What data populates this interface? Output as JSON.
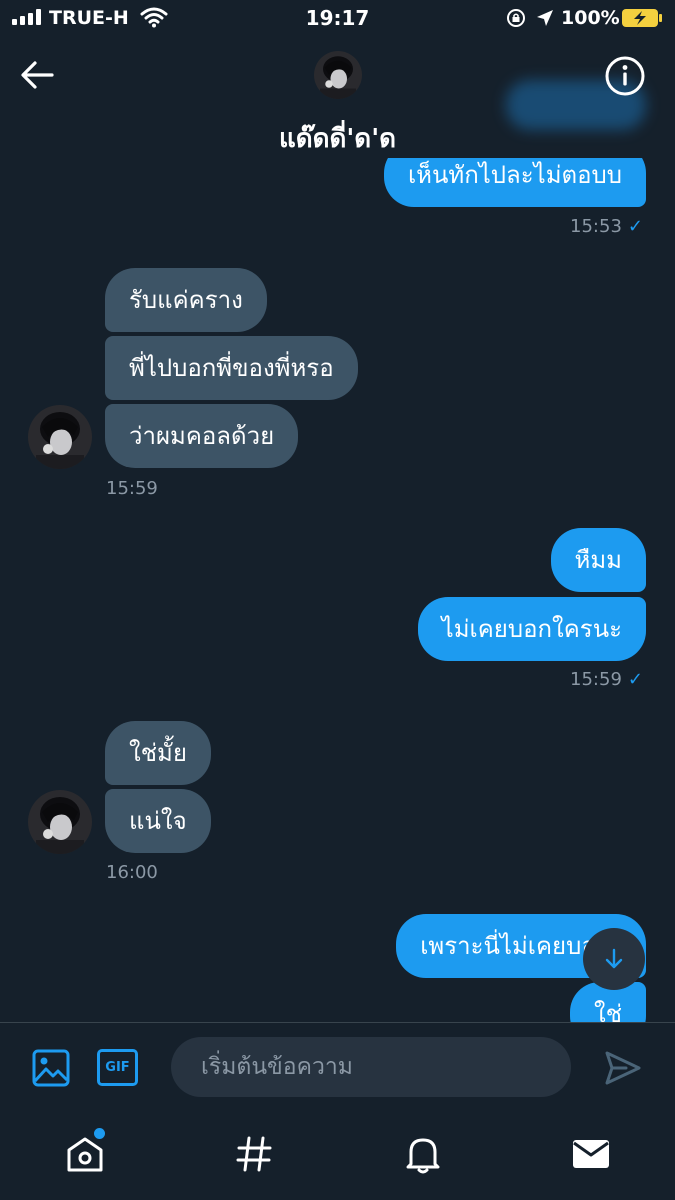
{
  "status_bar": {
    "carrier": "TRUE-H",
    "time": "19:17",
    "battery": "100%"
  },
  "header": {
    "contact_name": "แด๊ดดี่'ด'ด",
    "back_icon": "arrow-left-icon",
    "info_icon": "info-circle-icon"
  },
  "messages": [
    {
      "id": "m1",
      "direction": "out",
      "text": "เห็นทักไปละไม่ตอบบ"
    },
    {
      "id": "t1",
      "time": "15:53",
      "read": true
    },
    {
      "id": "m2",
      "direction": "in",
      "text": "รับแค่คราง"
    },
    {
      "id": "m3",
      "direction": "in",
      "text": "พี่ไปบอกพี่ของพี่หรอ"
    },
    {
      "id": "m4",
      "direction": "in",
      "text": "ว่าผมคอลด้วย"
    },
    {
      "id": "t2",
      "time": "15:59"
    },
    {
      "id": "m5",
      "direction": "out",
      "text": "หืมม"
    },
    {
      "id": "m6",
      "direction": "out",
      "text": "ไม่เคยบอกใครนะ"
    },
    {
      "id": "t3",
      "time": "15:59",
      "read": true
    },
    {
      "id": "m7",
      "direction": "in",
      "text": "ใช่มั้ย"
    },
    {
      "id": "m8",
      "direction": "in",
      "text": "แน่ใจ"
    },
    {
      "id": "t4",
      "time": "16:00"
    },
    {
      "id": "m9",
      "direction": "out",
      "text": "เพราะนี่ไม่เคยบอกใ"
    },
    {
      "id": "m10",
      "direction": "out",
      "text": "ใช่"
    }
  ],
  "composer": {
    "placeholder": "เริ่มต้นข้อความ",
    "gif_label": "GIF"
  },
  "tabbar": {
    "items": [
      "home-icon",
      "hashtag-icon",
      "bell-icon",
      "mail-icon"
    ],
    "home_has_notification": true
  },
  "colors": {
    "background": "#15202b",
    "incoming_bubble": "#3d5466",
    "outgoing_bubble": "#1d9bf0",
    "muted_text": "#8b98a5"
  }
}
